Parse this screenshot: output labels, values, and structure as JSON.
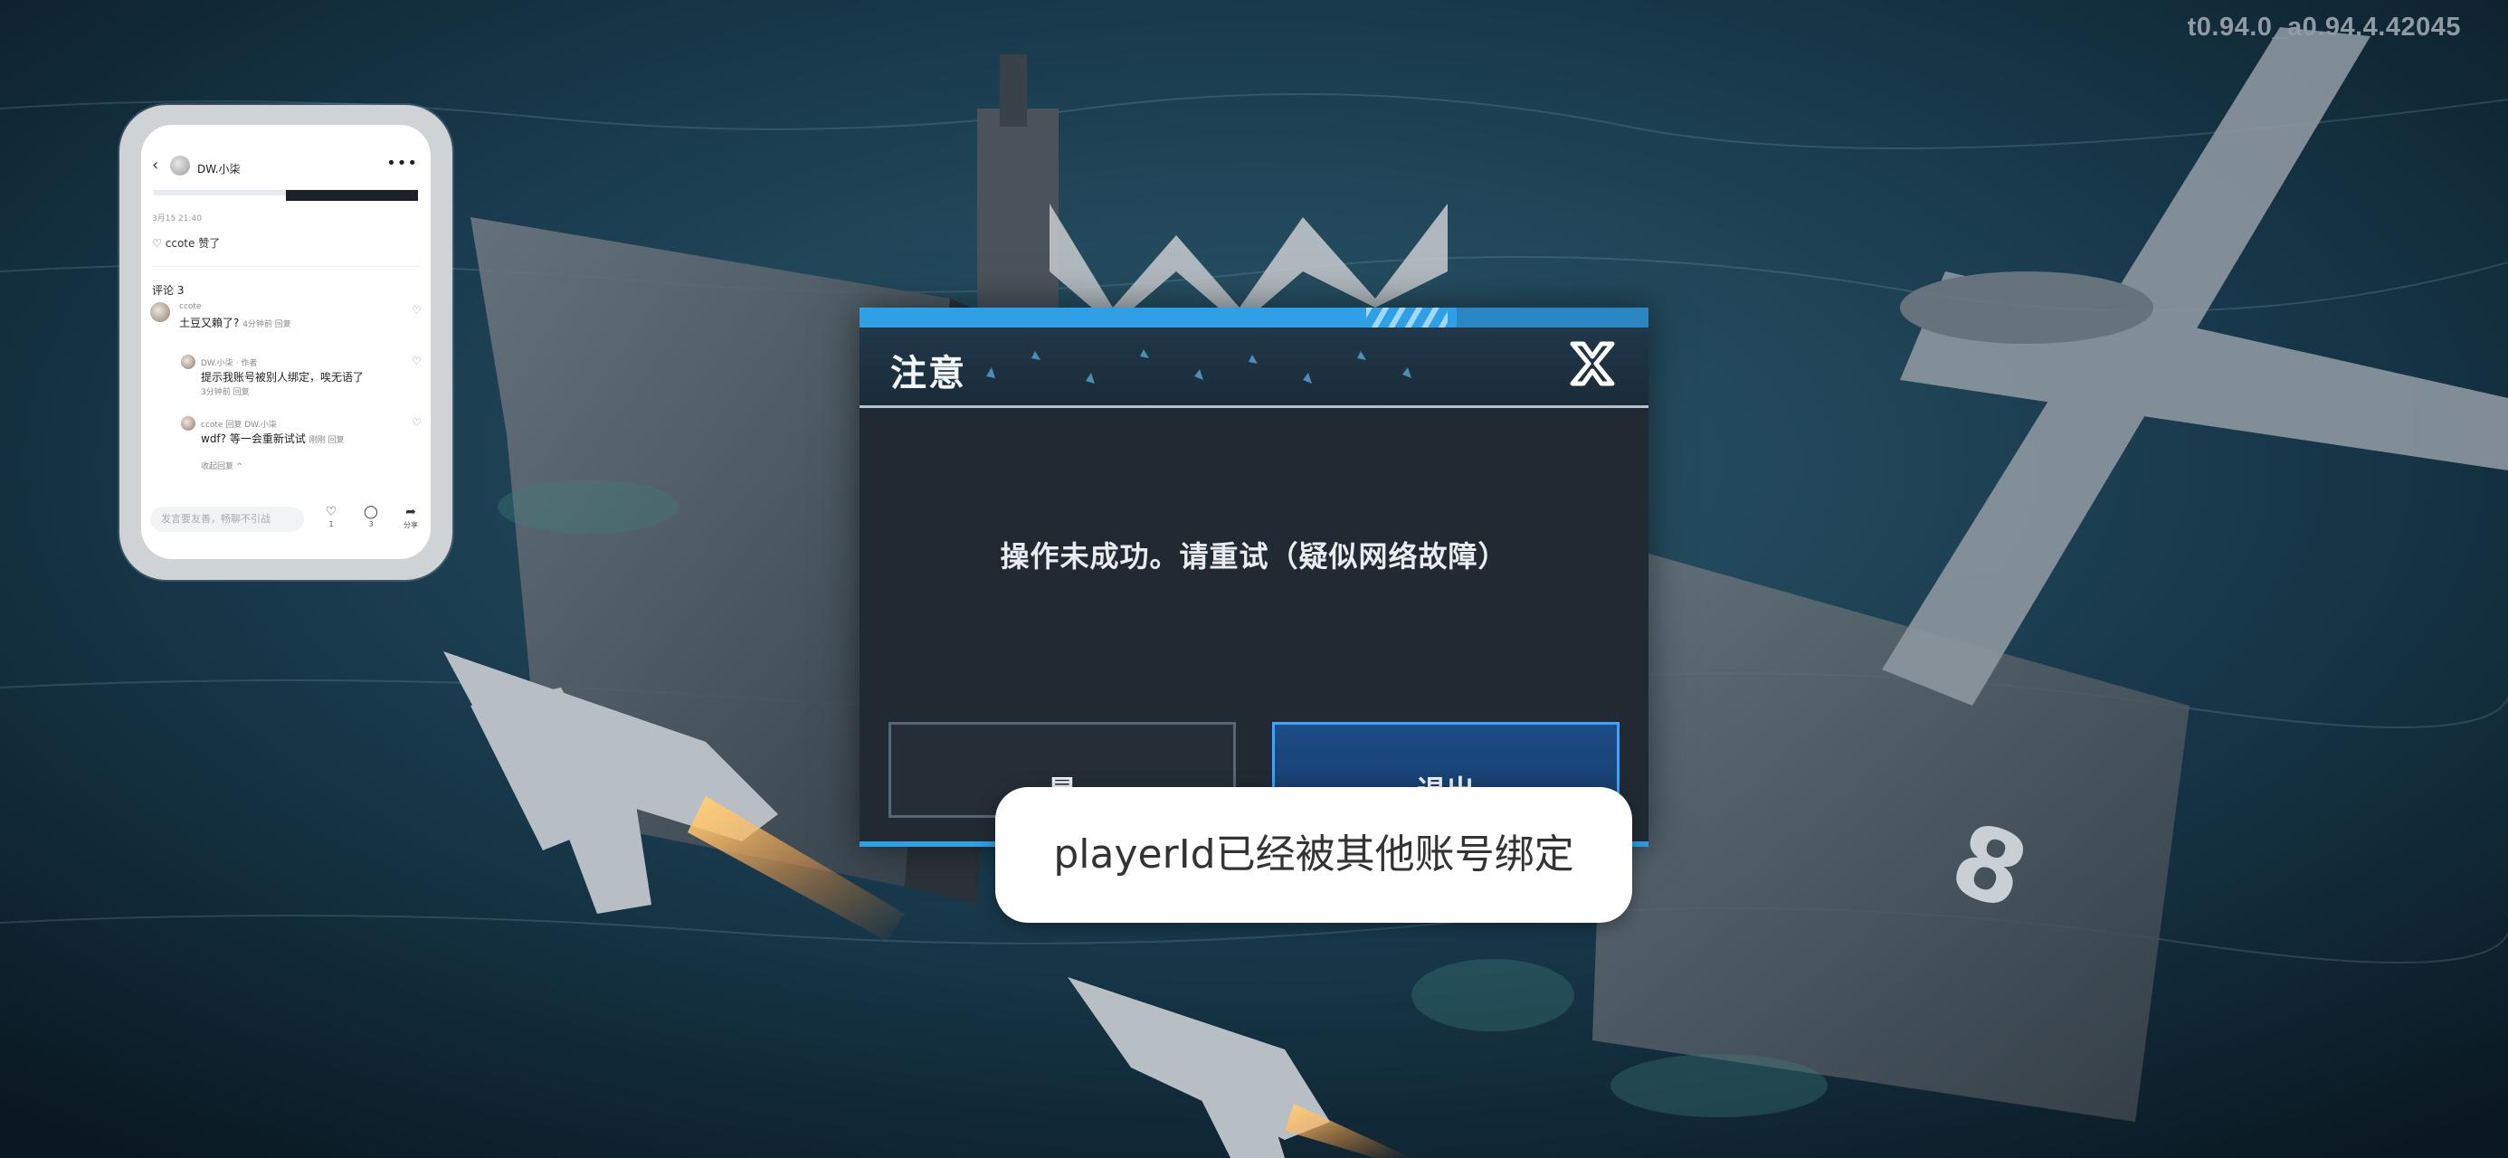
{
  "version": "t0.94.0_a0.94.4.42045",
  "phone": {
    "username": "DW.小柒",
    "date": "3月15  21:40",
    "like_line": "ccote 赞了",
    "comments_title": "评论 3",
    "comments": [
      {
        "name": "ccote",
        "text": "土豆又賴了?",
        "meta": "4分钟前 回复"
      },
      {
        "name": "DW.小柒 · 作者",
        "text": "提示我账号被别人绑定，唉无语了",
        "meta": "3分钟前 回复"
      },
      {
        "name": "ccote 回复 DW.小柒",
        "text": "wdf? 等一会重新试试",
        "meta": "刚刚 回复"
      }
    ],
    "collapse": "收起回复 ^",
    "input_placeholder": "发言要友善，畅聊不引战",
    "actions": {
      "like_count": "1",
      "comment_count": "3",
      "share_label": "分享"
    }
  },
  "dialog": {
    "title": "注意",
    "message": "操作未成功。请重试（疑似网络故障）",
    "yes_label": "是",
    "exit_label": "退出"
  },
  "toast": "playerId已经被其他账号绑定",
  "icons": {
    "close": "close-icon",
    "back": "back-icon",
    "more": "more-icon",
    "heart": "heart-icon",
    "comment": "comment-icon",
    "share": "share-icon"
  },
  "colors": {
    "accent": "#2f9fe6",
    "exit_border": "#3da3ff",
    "dialog_bg": "#212a33"
  }
}
